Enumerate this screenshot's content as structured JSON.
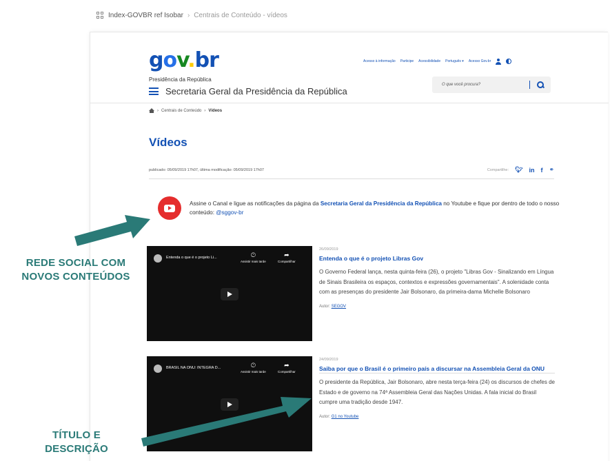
{
  "tool_breadcrumb": {
    "project": "Index-GOVBR ref Isobar",
    "page": "Centrais de Conteúdo - vídeos"
  },
  "site": {
    "logo": {
      "g": "g",
      "o": "o",
      "v": "v",
      "dot": ".",
      "b": "b",
      "r": "r"
    },
    "org": "Presidência da República",
    "title": "Secretaria Geral da Presidência da República",
    "top_links": [
      "Acesso à informação",
      "Participe",
      "Acessibilidade",
      "Português ▾",
      "Acesso Gov.br"
    ],
    "search_placeholder": "O que você procura?"
  },
  "breadcrumb": {
    "parent": "Centrais de Conteúdo",
    "current": "Vídeos"
  },
  "page": {
    "title": "Vídeos",
    "meta": "publicado: 05/09/2019 17h07, última modificação: 05/09/2019 17h07",
    "share_label": "Compartilhe:",
    "share_icons": [
      "twitter-icon",
      "linkedin-icon",
      "facebook-icon",
      "link-icon"
    ]
  },
  "youtube_banner": {
    "text_before": "Assine o Canal e ligue as notificações da página da ",
    "bold": "Secretaria Geral da Presidência da República",
    "text_after": " no Youtube e fique por dentro de todo o nosso conteúdo: ",
    "link": "@sggov-br"
  },
  "videos": [
    {
      "thumb_title": "Entenda o que é o projeto Li...",
      "watch_later": "Assistir mais tarde",
      "share": "Compartilhar",
      "date": "26/09/2019",
      "title": "Entenda o que é o projeto Libras Gov",
      "description": "O Governo Federal lança, nesta quinta-feira (26), o projeto \"Libras Gov - Sinalizando em Língua de Sinais Brasileira os espaços, contextos e expressões governamentais\". A solenidade conta com as presenças do presidente Jair Bolsonaro, da primeira-dama Michelle Bolsonaro",
      "author_label": "Autor:",
      "author": "SEGOV"
    },
    {
      "thumb_title": "BRASIL NA ONU: INTEGRA D...",
      "watch_later": "Assistir mais tarde",
      "share": "Compartilhar",
      "date": "24/09/2019",
      "title": "Saiba por que o Brasil é o primeiro país a discursar na Assembleia Geral da ONU",
      "description": "O presidente da República, Jair Bolsonaro, abre nesta terça-feira (24) os discursos de chefes de Estado e de governo na 74ª Assembleia Geral das Nações Unidas. A fala inicial do Brasil cumpre uma tradição desde 1947.",
      "author_label": "Autor:",
      "author": "G1 no Youtube"
    }
  ],
  "annotations": {
    "social": "REDE SOCIAL COM NOVOS CONTEÚDOS",
    "title_desc": "TÍTULO E DESCRIÇÃO"
  },
  "colors": {
    "govbr_blue": "#1351b4",
    "annotation_teal": "#2a7a77",
    "youtube_red": "#e52d2d"
  }
}
